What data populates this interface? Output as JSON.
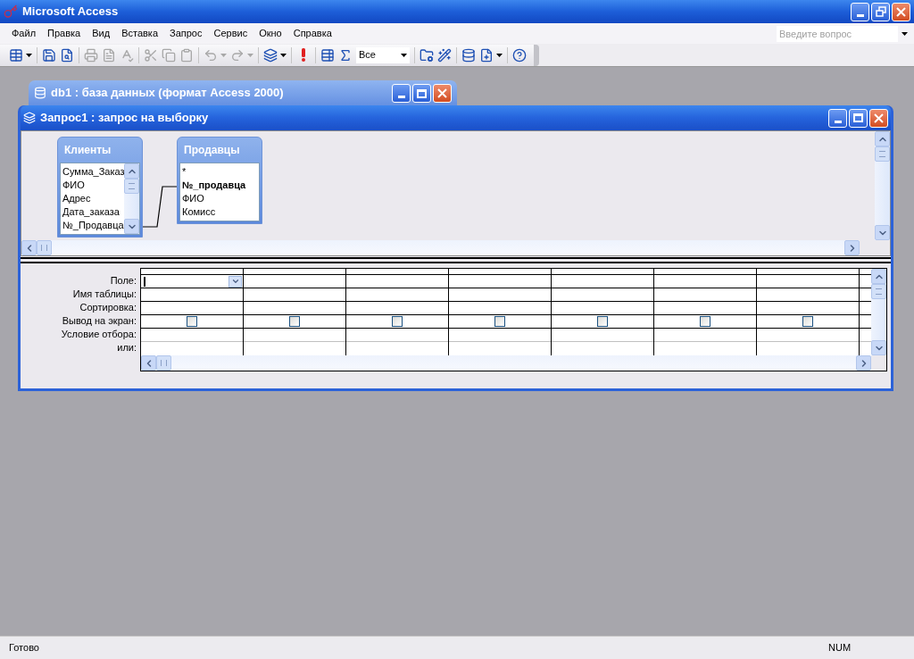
{
  "window": {
    "title": "Microsoft Access"
  },
  "menu": [
    {
      "label": "Файл"
    },
    {
      "label": "Правка"
    },
    {
      "label": "Вид"
    },
    {
      "label": "Вставка"
    },
    {
      "label": "Запрос"
    },
    {
      "label": "Сервис"
    },
    {
      "label": "Окно"
    },
    {
      "label": "Справка"
    }
  ],
  "help_search": {
    "placeholder": "Введите вопрос"
  },
  "toolbar": [
    {
      "kind": "view",
      "disabled": false
    },
    {
      "kind": "separator"
    },
    {
      "kind": "save",
      "disabled": false
    },
    {
      "kind": "search",
      "disabled": false
    },
    {
      "kind": "separator"
    },
    {
      "kind": "print",
      "disabled": true
    },
    {
      "kind": "preview",
      "disabled": true
    },
    {
      "kind": "spelling",
      "disabled": true
    },
    {
      "kind": "separator"
    },
    {
      "kind": "cut",
      "disabled": true
    },
    {
      "kind": "copy",
      "disabled": true
    },
    {
      "kind": "paste",
      "disabled": true
    },
    {
      "kind": "separator"
    },
    {
      "kind": "undo",
      "disabled": true
    },
    {
      "kind": "redo",
      "disabled": true
    },
    {
      "kind": "separator"
    },
    {
      "kind": "query_type",
      "disabled": false
    },
    {
      "kind": "separator"
    },
    {
      "kind": "run",
      "disabled": false
    },
    {
      "kind": "separator"
    },
    {
      "kind": "show_table",
      "disabled": false
    },
    {
      "kind": "totals",
      "disabled": false
    },
    {
      "kind": "combo",
      "value": "Все"
    },
    {
      "kind": "separator"
    },
    {
      "kind": "properties",
      "disabled": false
    },
    {
      "kind": "builder",
      "disabled": false
    },
    {
      "kind": "separator"
    },
    {
      "kind": "database_window",
      "disabled": false
    },
    {
      "kind": "new_object",
      "disabled": false
    },
    {
      "kind": "separator"
    },
    {
      "kind": "help",
      "disabled": false
    }
  ],
  "database_window": {
    "title": "db1 : база данных (формат Access 2000)"
  },
  "query_window": {
    "title": "Запрос1 : запрос на выборку",
    "tables": [
      {
        "name": "Клиенты",
        "fields": [
          {
            "name": "Сумма_Заказ",
            "key": false
          },
          {
            "name": "ФИО",
            "key": false
          },
          {
            "name": "Адрес",
            "key": false
          },
          {
            "name": "Дата_заказа",
            "key": false
          },
          {
            "name": "№_Продавца",
            "key": false
          }
        ]
      },
      {
        "name": "Продавцы",
        "fields": [
          {
            "name": "*",
            "key": false
          },
          {
            "name": "№_продавца",
            "key": true
          },
          {
            "name": "ФИО",
            "key": false
          },
          {
            "name": "Комисс",
            "key": false
          }
        ]
      }
    ],
    "grid": {
      "row_labels": [
        "Поле:",
        "Имя таблицы:",
        "Сортировка:",
        "Вывод на экран:",
        "Условие отбора:",
        "или:"
      ],
      "columns": [
        {
          "show": false
        },
        {
          "show": false
        },
        {
          "show": false
        },
        {
          "show": false
        },
        {
          "show": false
        },
        {
          "show": false
        },
        {
          "show": false
        }
      ]
    }
  },
  "status_bar": {
    "text": "Готово",
    "indicator": "NUM"
  }
}
